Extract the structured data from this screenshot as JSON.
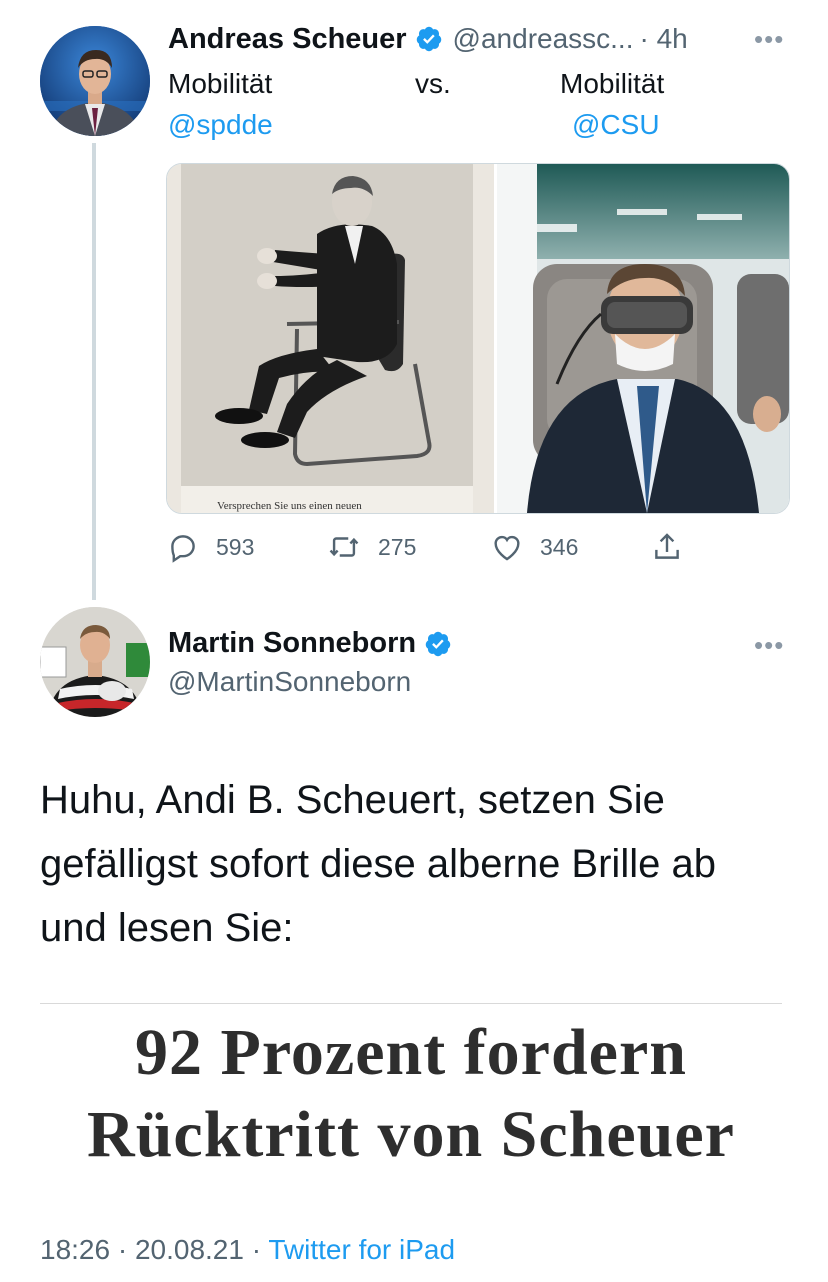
{
  "tweet1": {
    "author_name": "Andreas Scheuer",
    "handle": "@andreassc...",
    "time": "· 4h",
    "text_line1_left": "Mobilität",
    "text_line1_mid": "vs.",
    "text_line1_right": "Mobilität",
    "mention_left": "@spdde",
    "mention_right": "@CSU",
    "image_left_caption": "Versprechen Sie uns einen neuen",
    "reply_count": "593",
    "retweet_count": "275",
    "like_count": "346"
  },
  "tweet2": {
    "author_name": "Martin Sonneborn",
    "handle": "@MartinSonneborn",
    "text_line1": "Huhu, Andi B. Scheuert, setzen Sie",
    "text_line2": "gefälligst sofort diese alberne Brille ab",
    "text_line3": "und lesen Sie:",
    "headline_line1": "92 Prozent fordern",
    "headline_line2": "Rücktritt von Scheuer",
    "timestamp": "18:26 · 20.08.21 · ",
    "source": "Twitter for iPad"
  },
  "colors": {
    "accent": "#1d9bf0",
    "verified": "#1d9bf0",
    "muted": "#536471"
  },
  "icons": [
    "more-icon",
    "verified-icon",
    "reply-icon",
    "retweet-icon",
    "like-icon",
    "share-icon"
  ]
}
